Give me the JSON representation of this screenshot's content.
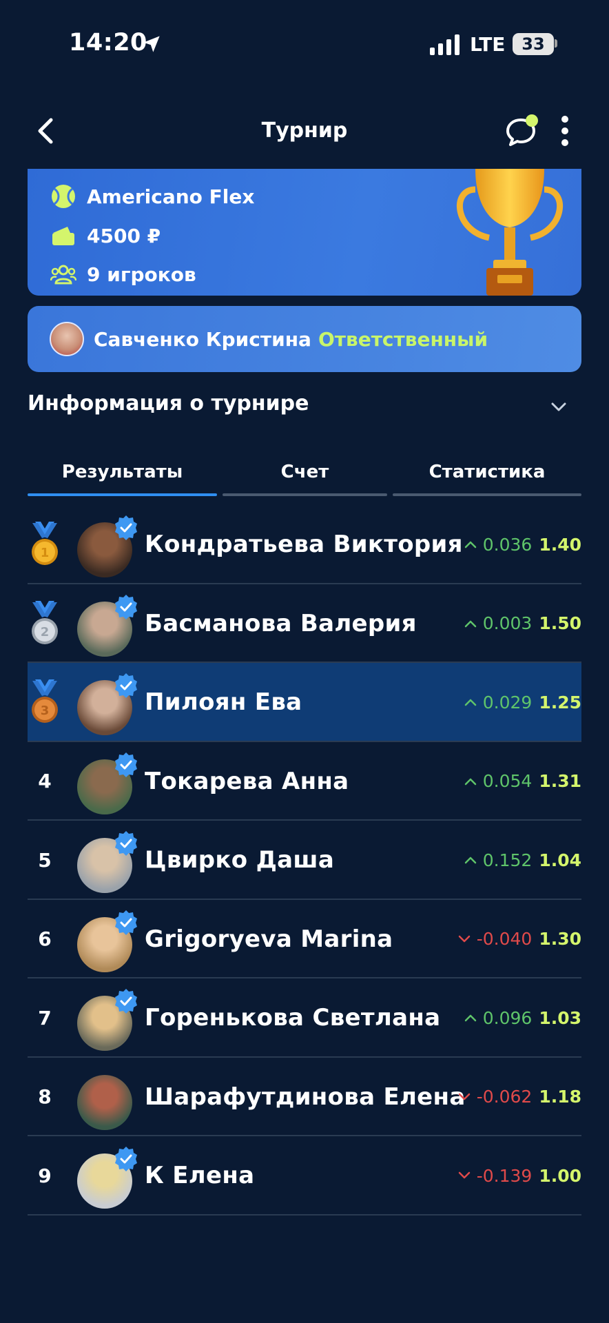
{
  "status": {
    "time": "14:20",
    "network": "LTE",
    "battery": "33"
  },
  "nav": {
    "title": "Турнир"
  },
  "tournament": {
    "format": "Americano Flex",
    "price": "4500 ₽",
    "players_count": "9 игроков"
  },
  "organizer": {
    "name": "Савченко Кристина",
    "role": "Ответственный"
  },
  "info": {
    "title": "Информация о турнире"
  },
  "tabs": [
    {
      "label": "Результаты",
      "active": true
    },
    {
      "label": "Счет",
      "active": false
    },
    {
      "label": "Статистика",
      "active": false
    }
  ],
  "colors": {
    "accent": "#2f8ef0",
    "rating": "#d4f56c",
    "up": "#5fc46a",
    "down": "#e04a4a",
    "role": "#c8f56a"
  },
  "results": [
    {
      "rank": "1",
      "medal": "gold",
      "name": "Кондратьева Виктория",
      "delta": "0.036",
      "trend": "up",
      "rating": "1.40",
      "verified": true
    },
    {
      "rank": "2",
      "medal": "silver",
      "name": "Басманова Валерия",
      "delta": "0.003",
      "trend": "up",
      "rating": "1.50",
      "verified": true
    },
    {
      "rank": "3",
      "medal": "bronze",
      "name": "Пилоян Ева",
      "delta": "0.029",
      "trend": "up",
      "rating": "1.25",
      "verified": true
    },
    {
      "rank": "4",
      "medal": "",
      "name": "Токарева Анна",
      "delta": "0.054",
      "trend": "up",
      "rating": "1.31",
      "verified": true
    },
    {
      "rank": "5",
      "medal": "",
      "name": "Цвирко Даша",
      "delta": "0.152",
      "trend": "up",
      "rating": "1.04",
      "verified": true
    },
    {
      "rank": "6",
      "medal": "",
      "name": "Grigoryeva Marina",
      "delta": "-0.040",
      "trend": "down",
      "rating": "1.30",
      "verified": true
    },
    {
      "rank": "7",
      "medal": "",
      "name": "Горенькова Светлана",
      "delta": "0.096",
      "trend": "up",
      "rating": "1.03",
      "verified": true
    },
    {
      "rank": "8",
      "medal": "",
      "name": "Шарафутдинова Елена",
      "delta": "-0.062",
      "trend": "down",
      "rating": "1.18",
      "verified": false
    },
    {
      "rank": "9",
      "medal": "",
      "name": "К Елена",
      "delta": "-0.139",
      "trend": "down",
      "rating": "1.00",
      "verified": true
    }
  ]
}
